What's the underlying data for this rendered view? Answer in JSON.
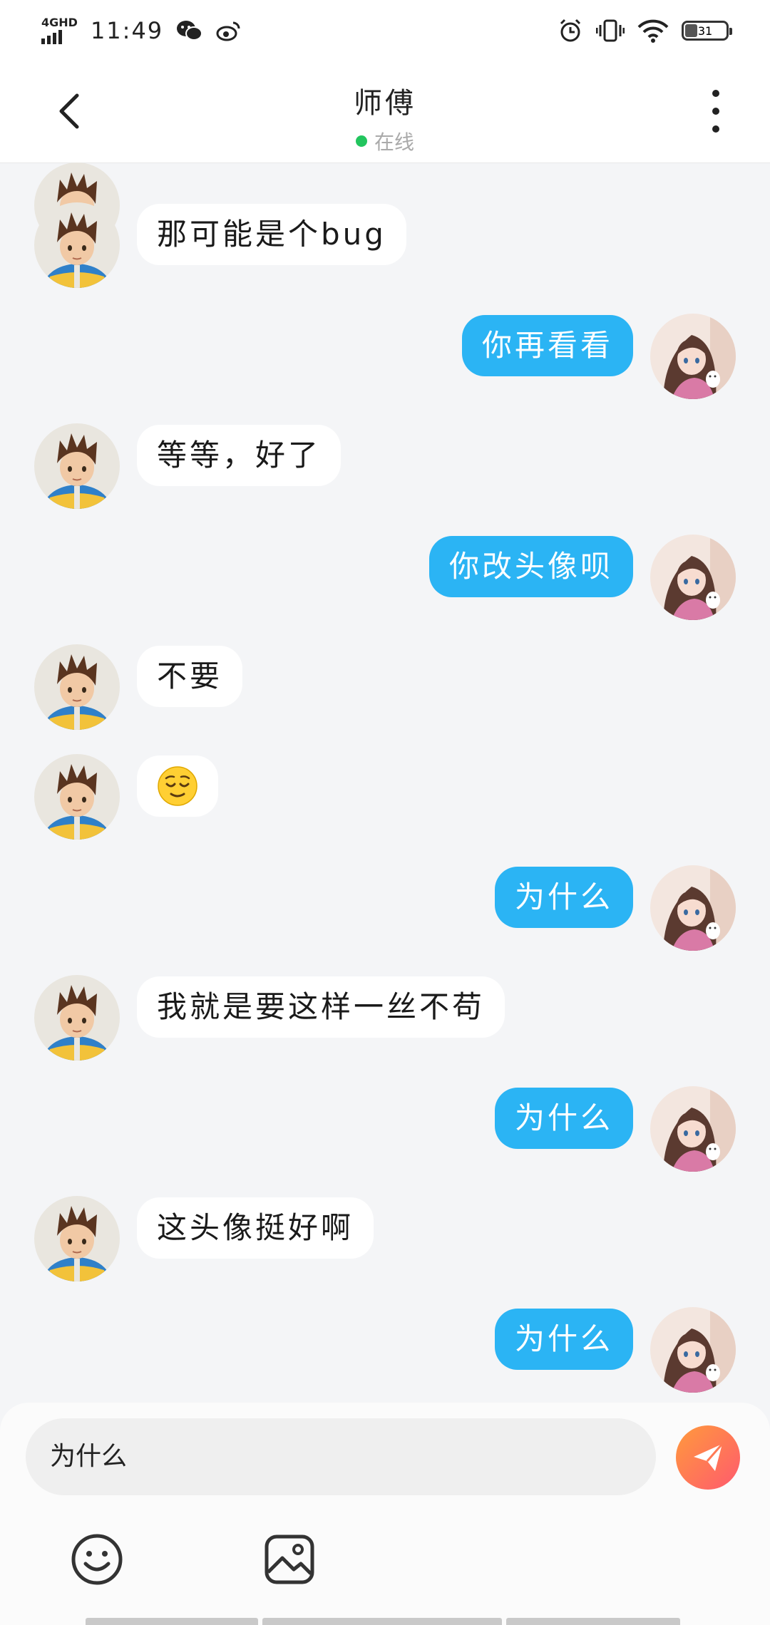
{
  "status_bar": {
    "network": "4GHD",
    "time": "11:49",
    "battery": "31",
    "icons": [
      "signal-icon",
      "wechat-icon",
      "weibo-icon",
      "alarm-icon",
      "vibrate-icon",
      "wifi-icon",
      "battery-icon"
    ]
  },
  "header": {
    "title": "师傅",
    "status": "在线",
    "status_color": "#22c55e",
    "back_icon": "chevron-left-icon",
    "more_icon": "more-vertical-icon"
  },
  "messages": [
    {
      "side": "left",
      "text": "那可能是个bug"
    },
    {
      "side": "right",
      "text": "你再看看"
    },
    {
      "side": "left",
      "text": "等等，好了"
    },
    {
      "side": "right",
      "text": "你改头像呗"
    },
    {
      "side": "left",
      "text": "不要"
    },
    {
      "side": "left",
      "emoji": "relieved-face-icon"
    },
    {
      "side": "right",
      "text": "为什么"
    },
    {
      "side": "left",
      "text": "我就是要这样一丝不苟"
    },
    {
      "side": "right",
      "text": "为什么"
    },
    {
      "side": "left",
      "text": "这头像挺好啊"
    },
    {
      "side": "right",
      "text": "为什么"
    }
  ],
  "composer": {
    "input_value": "为什么",
    "send_icon": "send-icon",
    "emoji_icon": "smiley-icon",
    "image_icon": "image-icon"
  },
  "colors": {
    "outgoing_bubble": "#2bb4f4",
    "incoming_bubble": "#ffffff",
    "chat_background": "#f4f5f7",
    "send_gradient": [
      "#ff9a3c",
      "#ff5a6e"
    ]
  }
}
